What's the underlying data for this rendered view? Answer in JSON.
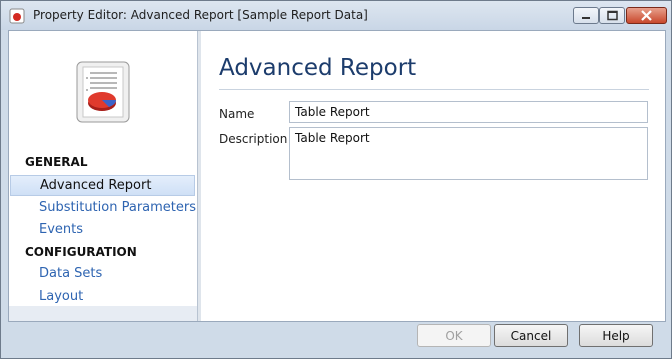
{
  "window": {
    "title": "Property Editor: Advanced Report [Sample Report Data]"
  },
  "sidebar": {
    "sections": [
      {
        "heading": "GENERAL",
        "items": [
          {
            "label": "Advanced Report",
            "selected": true
          },
          {
            "label": "Substitution Parameters",
            "selected": false
          },
          {
            "label": "Events",
            "selected": false
          }
        ]
      },
      {
        "heading": "CONFIGURATION",
        "items": [
          {
            "label": "Data Sets",
            "selected": false
          },
          {
            "label": "Layout",
            "selected": false
          }
        ]
      }
    ]
  },
  "main": {
    "title": "Advanced Report",
    "name_label": "Name",
    "name_value": "Table Report",
    "description_label": "Description",
    "description_value": "Table Report"
  },
  "footer": {
    "ok_label": "OK",
    "cancel_label": "Cancel",
    "help_label": "Help"
  },
  "colors": {
    "accent": "#2e64b1",
    "title": "#1c3c6c",
    "selection": "#cfe0f6"
  }
}
